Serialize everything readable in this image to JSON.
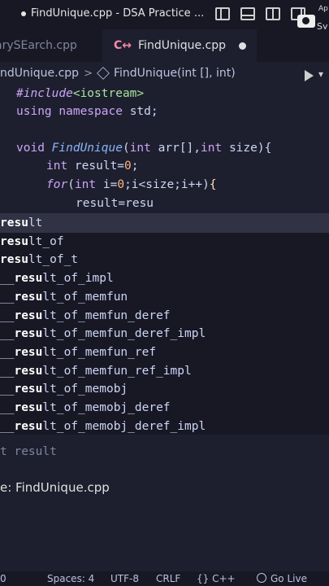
{
  "window": {
    "title": "FindUnique.cpp - DSA Practice ...",
    "sys_right": "Ap",
    "sys_right2": "Sy"
  },
  "tabs": [
    {
      "label": "arySEarch.cpp"
    },
    {
      "label": "FindUnique.cpp",
      "icon": "C↔"
    }
  ],
  "breadcrumb": {
    "file": "ndUnique.cpp",
    "symbol": "FindUnique(int [], int)"
  },
  "code": {
    "l1_inc": "#include",
    "l1_hdr": "<iostream>",
    "l2_using": "using",
    "l2_ns": "namespace",
    "l2_std": "std;",
    "l3_void": "void",
    "l3_fn": "FindUnique",
    "l3_open": "(",
    "l3_int": "int",
    "l3_arr": " arr[],",
    "l3_int2": "int",
    "l3_rest": " size){",
    "l4_int": "int",
    "l4_rest": " result=",
    "l4_num": "0",
    "l4_semi": ";",
    "l5_for": "for",
    "l5_open": "(",
    "l5_int": "int",
    "l5_i": " i=",
    "l5_zero": "0",
    "l5_rest": ";i<size;i++)",
    "l5_brace": "{",
    "l6_text": "result=resu"
  },
  "suggestions": [
    {
      "match": "resu",
      "rest": "lt",
      "prefix": ""
    },
    {
      "match": "resu",
      "rest": "lt_of",
      "prefix": ""
    },
    {
      "match": "resu",
      "rest": "lt_of_t",
      "prefix": ""
    },
    {
      "match": "resu",
      "rest": "lt_of_impl",
      "prefix": "__"
    },
    {
      "match": "resu",
      "rest": "lt_of_memfun",
      "prefix": "__"
    },
    {
      "match": "resu",
      "rest": "lt_of_memfun_deref",
      "prefix": "__"
    },
    {
      "match": "resu",
      "rest": "lt_of_memfun_deref_impl",
      "prefix": "__"
    },
    {
      "match": "resu",
      "rest": "lt_of_memfun_ref",
      "prefix": "__"
    },
    {
      "match": "resu",
      "rest": "lt_of_memfun_ref_impl",
      "prefix": "__"
    },
    {
      "match": "resu",
      "rest": "lt_of_memobj",
      "prefix": "__"
    },
    {
      "match": "resu",
      "rest": "lt_of_memobj_deref",
      "prefix": "__"
    },
    {
      "match": "resu",
      "rest": "lt_of_memobj_deref_impl",
      "prefix": "__"
    }
  ],
  "suggest_detail": "t result",
  "suggest_origin": "e: FindUnique.cpp",
  "statusbar": {
    "zero": "0",
    "spaces": "Spaces: 4",
    "encoding": "UTF-8",
    "eol": "CRLF",
    "lang": "{} C++",
    "golive": "Go Live"
  }
}
